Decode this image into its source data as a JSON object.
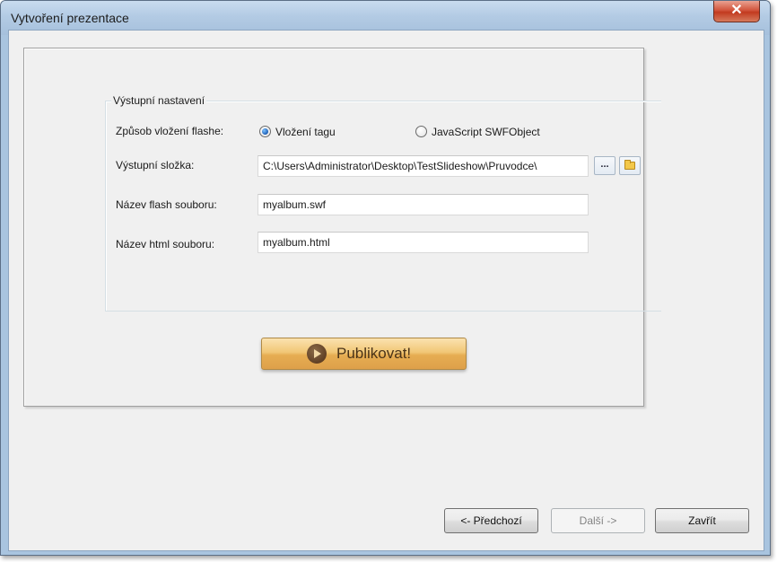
{
  "window": {
    "title": "Vytvoření prezentace",
    "close_glyph": "✕"
  },
  "output_settings": {
    "group_title": "Výstupní nastavení",
    "embed_method": {
      "label": "Způsob vložení flashe:",
      "options": [
        {
          "label": "Vložení tagu",
          "selected": true
        },
        {
          "label": "JavaScript SWFObject",
          "selected": false
        }
      ]
    },
    "output_folder": {
      "label": "Výstupní složka:",
      "value": "C:\\Users\\Administrator\\Desktop\\TestSlideshow\\Pruvodce\\",
      "browse_label": "...",
      "open_folder_icon": "folder-open-icon"
    },
    "flash_file": {
      "label": "Název flash souboru:",
      "value": "myalbum.swf"
    },
    "html_file": {
      "label": "Název html souboru:",
      "value": "myalbum.html"
    }
  },
  "publish": {
    "label": "Publikovat!",
    "icon": "play-icon"
  },
  "navigation": {
    "previous_label": "<- Předchozí",
    "next_label": "Další ->",
    "close_label": "Zavřít"
  },
  "colors": {
    "titlebar": "#b3cbe4",
    "publish_button": "#f1c776",
    "radio_selected": "#1b5db5"
  }
}
